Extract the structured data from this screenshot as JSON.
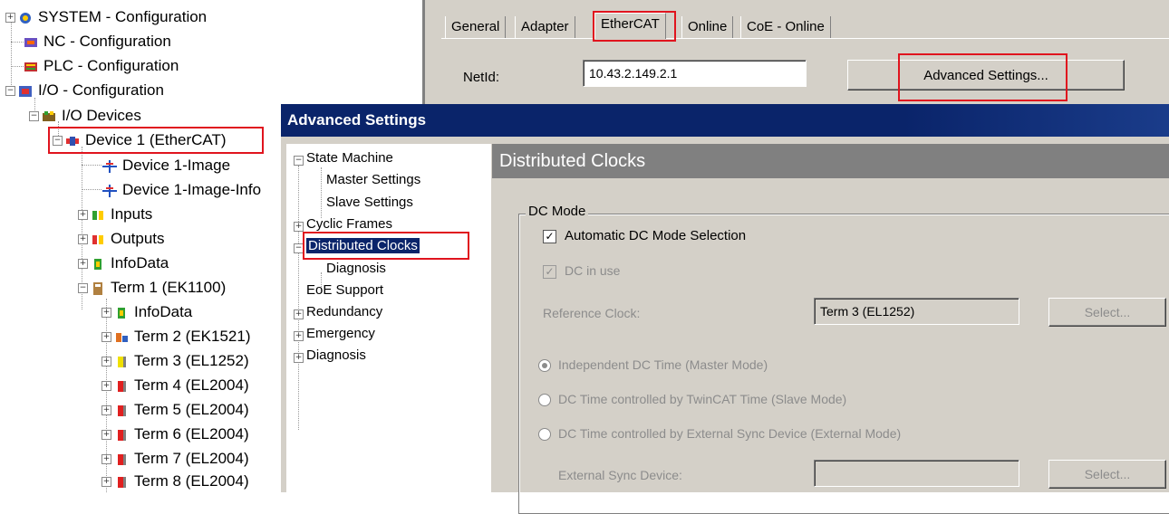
{
  "tree": {
    "items": [
      {
        "label": "SYSTEM - Configuration",
        "icon": "system-config-icon"
      },
      {
        "label": "NC - Configuration",
        "icon": "nc-config-icon"
      },
      {
        "label": "PLC - Configuration",
        "icon": "plc-config-icon"
      },
      {
        "label": "I/O - Configuration",
        "icon": "io-config-icon"
      },
      {
        "label": "I/O Devices",
        "icon": "io-devices-icon"
      },
      {
        "label": "Device 1 (EtherCAT)",
        "icon": "ethercat-device-icon"
      },
      {
        "label": "Device 1-Image",
        "icon": "image-icon"
      },
      {
        "label": "Device 1-Image-Info",
        "icon": "image-info-icon"
      },
      {
        "label": "Inputs",
        "icon": "inputs-icon"
      },
      {
        "label": "Outputs",
        "icon": "outputs-icon"
      },
      {
        "label": "InfoData",
        "icon": "infodata-icon"
      },
      {
        "label": "Term 1 (EK1100)",
        "icon": "coupler-icon"
      },
      {
        "label": "InfoData",
        "icon": "infodata-icon"
      },
      {
        "label": "Term 2 (EK1521)",
        "icon": "terminal-orange-icon"
      },
      {
        "label": "Term 3 (EL1252)",
        "icon": "terminal-yellow-icon"
      },
      {
        "label": "Term 4 (EL2004)",
        "icon": "terminal-red-icon"
      },
      {
        "label": "Term 5 (EL2004)",
        "icon": "terminal-red-icon"
      },
      {
        "label": "Term 6 (EL2004)",
        "icon": "terminal-red-icon"
      },
      {
        "label": "Term 7 (EL2004)",
        "icon": "terminal-red-icon"
      },
      {
        "label": "Term 8 (EL2004)",
        "icon": "terminal-red-icon"
      }
    ]
  },
  "tabs": {
    "items": [
      "General",
      "Adapter",
      "EtherCAT",
      "Online",
      "CoE - Online"
    ],
    "active": "EtherCAT"
  },
  "netid": {
    "label": "NetId:",
    "value": "10.43.2.149.2.1"
  },
  "advanced_button": "Advanced Settings...",
  "dialog": {
    "title": "Advanced Settings",
    "nav": [
      {
        "label": "State Machine"
      },
      {
        "label": "Master Settings"
      },
      {
        "label": "Slave Settings"
      },
      {
        "label": "Cyclic Frames"
      },
      {
        "label": "Distributed Clocks"
      },
      {
        "label": "Diagnosis"
      },
      {
        "label": "EoE Support"
      },
      {
        "label": "Redundancy"
      },
      {
        "label": "Emergency"
      },
      {
        "label": "Diagnosis"
      }
    ],
    "selected": "Distributed Clocks",
    "header": "Distributed Clocks",
    "group_label": "DC Mode",
    "auto_dc": "Automatic DC Mode Selection",
    "dc_in_use": "DC in use",
    "reference_clock_label": "Reference Clock:",
    "reference_clock_value": "Term 3 (EL1252)",
    "select_label": "Select...",
    "radios": [
      "Independent DC Time (Master Mode)",
      "DC Time controlled by TwinCAT Time (Slave Mode)",
      "DC Time controlled by External Sync Device (External Mode)"
    ],
    "external_sync_label": "External Sync Device:",
    "external_sync_value": "",
    "select2_label": "Select..."
  },
  "colors": {
    "highlight_red": "#e0141e",
    "dialog_title": "#0a246a",
    "panel": "#d4d0c8"
  }
}
